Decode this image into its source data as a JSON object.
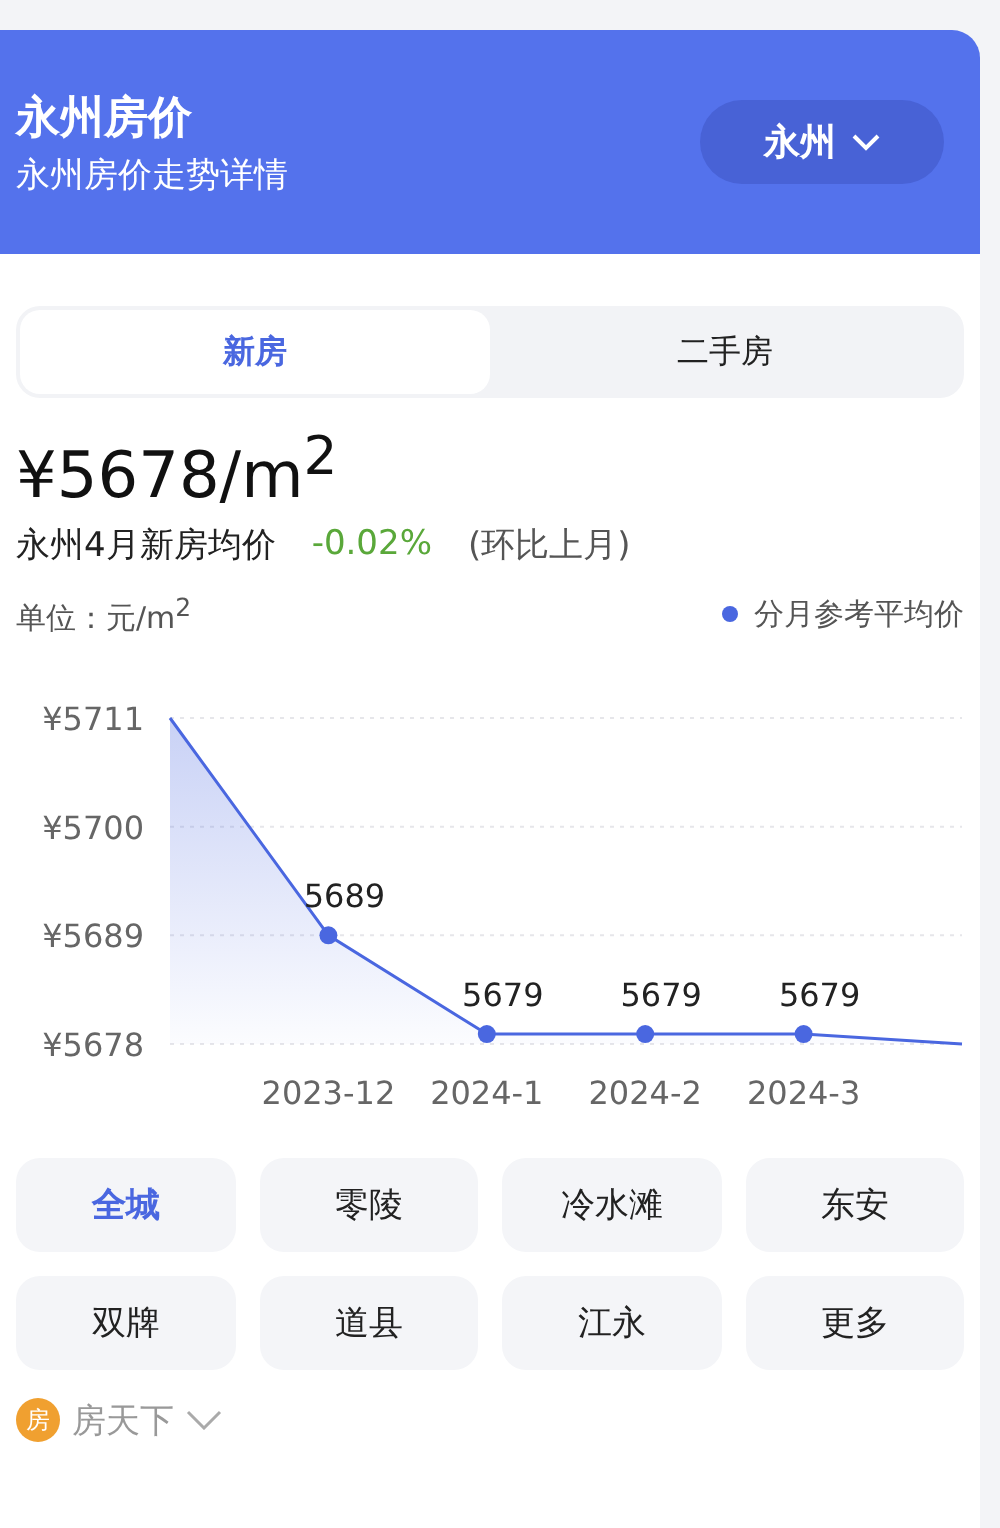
{
  "header": {
    "title": "永州房价",
    "subtitle": "永州房价走势详情",
    "city_button": "永州"
  },
  "tabs": [
    {
      "label": "新房",
      "selected": true
    },
    {
      "label": "二手房",
      "selected": false
    }
  ],
  "price": {
    "value": "¥5678/m$^{2}$",
    "caption": "永州4月新房均价",
    "change": "-0.02%",
    "change_note": "(环比上月)"
  },
  "chart": {
    "unit": "单位：元/m$^{2}$",
    "chart_data": {
      "type": "area",
      "categories": [
        null,
        "2023-12",
        "2024-1",
        "2024-2",
        "2024-3",
        null
      ],
      "yticks": [
        {
          "value": 5678,
          "label": "¥5678"
        },
        {
          "value": 5689,
          "label": "¥5689"
        },
        {
          "value": 5700,
          "label": "¥5700"
        },
        {
          "value": 5711,
          "label": "¥5711"
        }
      ],
      "ylim": [
        5678,
        5711
      ],
      "series": [
        {
          "name": "分月参考平均价",
          "color": "#4a67e0",
          "values": [
            5711,
            5689,
            5679,
            5679,
            5679,
            5678
          ]
        }
      ],
      "value_labels": [
        null,
        "5689",
        "5679",
        "5679",
        "5679",
        null
      ]
    }
  },
  "districts": [
    {
      "label": "全城",
      "selected": true
    },
    {
      "label": "零陵",
      "selected": false
    },
    {
      "label": "冷水滩",
      "selected": false
    },
    {
      "label": "东安",
      "selected": false
    },
    {
      "label": "双牌",
      "selected": false
    },
    {
      "label": "道县",
      "selected": false
    },
    {
      "label": "江永",
      "selected": false
    },
    {
      "label": "更多",
      "selected": false
    }
  ],
  "footer": {
    "logo_text": "房",
    "brand": "房天下"
  }
}
